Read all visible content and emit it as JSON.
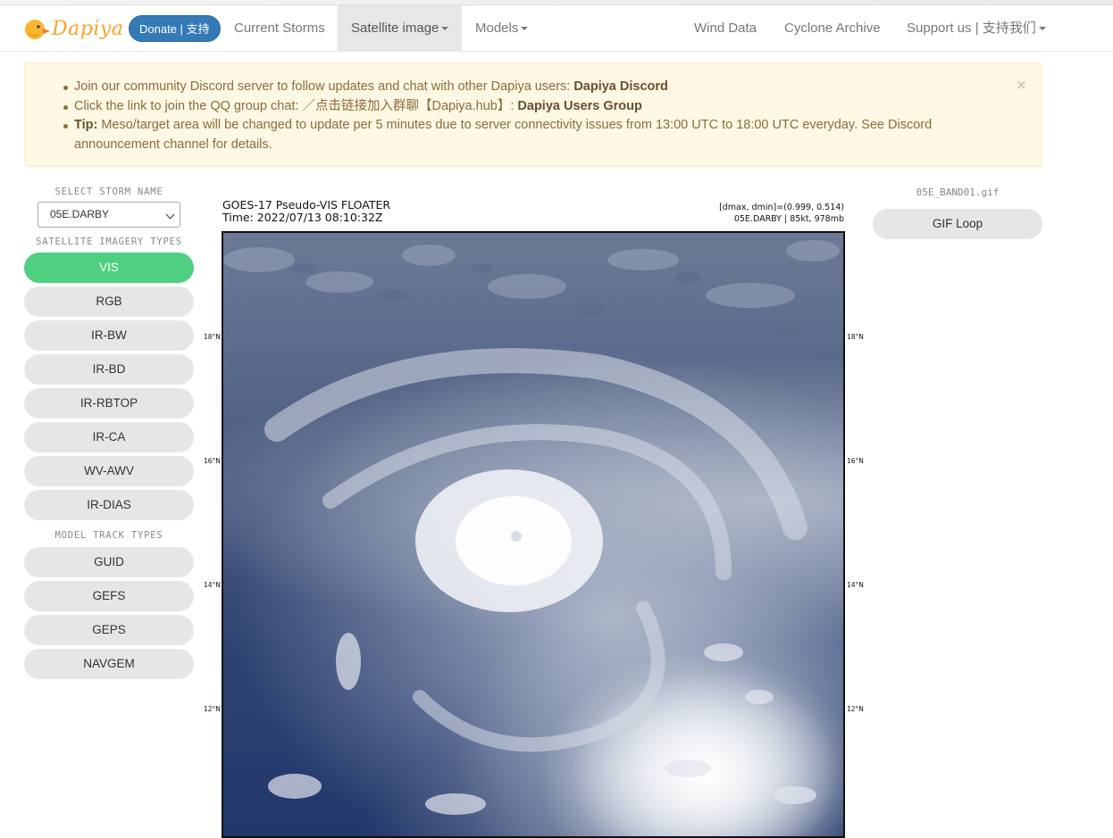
{
  "navbar": {
    "brand": "Dapiya",
    "donate_label": "Donate | 支持",
    "items": [
      {
        "label": "Current Storms"
      },
      {
        "label": "Satellite image"
      },
      {
        "label": "Models"
      },
      {
        "label": "Wind Data"
      },
      {
        "label": "Cyclone Archive"
      },
      {
        "label": "Support us | 支持我们"
      }
    ]
  },
  "alert": {
    "line1_text": "Join our community Discord server to follow updates and chat with other Dapiya users: ",
    "line1_link": "Dapiya Discord",
    "line2_text": "Click the link to join the QQ group chat: ／点击链接加入群聊【Dapiya.hub】: ",
    "line2_link": "Dapiya Users Group",
    "line3_bold": "Tip:",
    "line3_text": " Meso/target area will be changed to update per 5 minutes due to server connectivity issues from 13:00 UTC to 18:00 UTC everyday. See Discord announcement channel for details.",
    "close": "×"
  },
  "sidebar": {
    "storm_title": "SELECT STORM NAME",
    "storm_selected": "05E.DARBY",
    "imagery_title": "SATELLITE IMAGERY TYPES",
    "imagery_types": [
      "VIS",
      "RGB",
      "IR-BW",
      "IR-BD",
      "IR-RBTOP",
      "IR-CA",
      "WV-AWV",
      "IR-DIAS"
    ],
    "active_type": "VIS",
    "model_title": "MODEL TRACK TYPES",
    "model_types": [
      "GUID",
      "GEFS",
      "GEPS",
      "NAVGEM"
    ]
  },
  "figure": {
    "title_line1": "GOES-17 Pseudo-VIS FLOATER",
    "title_line2": "Time: 2022/07/13 08:10:32Z",
    "meta_line1": "[dmax, dmin]=(0.999, 0.514)",
    "meta_line2": "05E.DARBY | 85kt, 978mb",
    "lat_labels": [
      "18°N",
      "16°N",
      "14°N",
      "12°N"
    ]
  },
  "right_panel": {
    "gif_name": "05E_BAND01.gif",
    "gif_button": "GIF Loop"
  },
  "colors": {
    "accent_green": "#4fcf80",
    "donate_blue": "#337ab7",
    "alert_bg": "#fcf8e3",
    "alert_text": "#8a6d3b",
    "brand_orange": "#f5a623"
  }
}
